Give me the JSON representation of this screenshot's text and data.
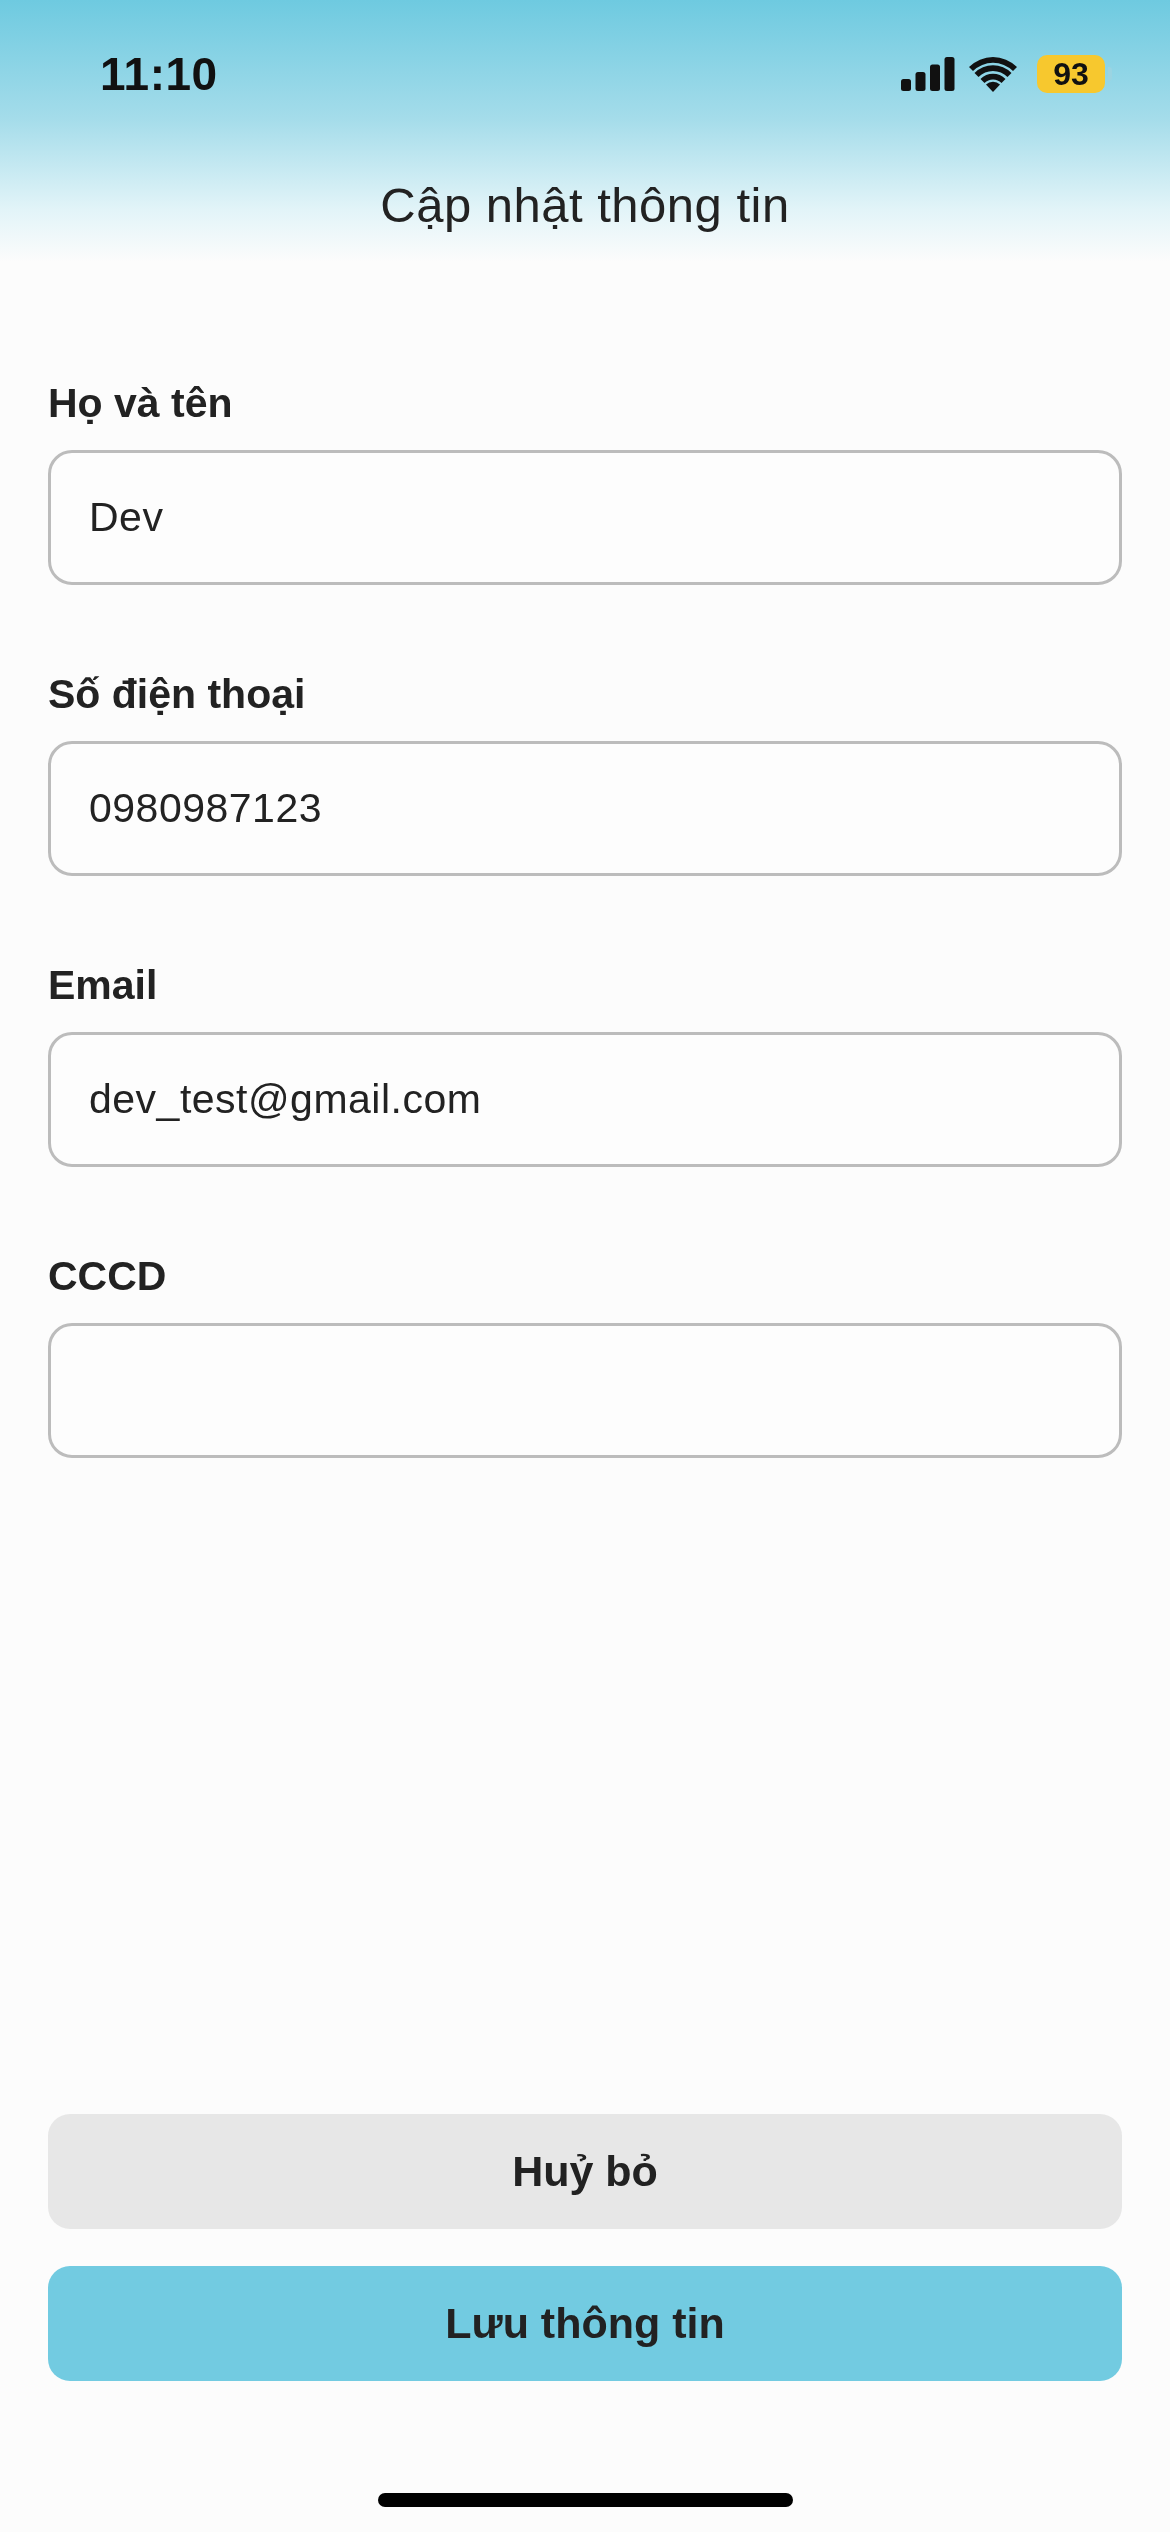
{
  "status_bar": {
    "time": "11:10",
    "battery": "93"
  },
  "header": {
    "title": "Cập nhật thông tin"
  },
  "form": {
    "fields": [
      {
        "label": "Họ và tên",
        "value": "Dev"
      },
      {
        "label": "Số điện thoại",
        "value": "0980987123"
      },
      {
        "label": "Email",
        "value": "dev_test@gmail.com"
      },
      {
        "label": "CCCD"
      }
    ]
  },
  "buttons": [
    {
      "label": "Huỷ bỏ",
      "kind": "secondary"
    },
    {
      "label": "Lưu thông tin",
      "kind": "primary"
    }
  ]
}
